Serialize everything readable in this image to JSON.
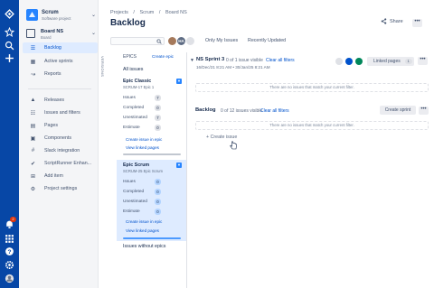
{
  "global_nav": {
    "icons": [
      "jira-logo-icon",
      "star-icon",
      "search-icon",
      "plus-icon",
      "notifications-icon",
      "apps-icon",
      "help-icon",
      "settings-icon",
      "profile-icon"
    ],
    "notification_count": "2",
    "bg_color": "#0747a6"
  },
  "project": {
    "name": "Scrum",
    "type": "Software project",
    "board_name": "Board NS",
    "board_sub": "Board"
  },
  "sidebar": {
    "primary": [
      {
        "label": "Backlog",
        "icon": "backlog-icon",
        "active": true
      },
      {
        "label": "Active sprints",
        "icon": "sprint-icon",
        "active": false
      },
      {
        "label": "Reports",
        "icon": "reports-icon",
        "active": false
      }
    ],
    "secondary": [
      {
        "label": "Releases",
        "icon": "ship-icon"
      },
      {
        "label": "Issues and filters",
        "icon": "issues-icon"
      },
      {
        "label": "Pages",
        "icon": "page-icon"
      },
      {
        "label": "Components",
        "icon": "component-icon"
      },
      {
        "label": "Slack integration",
        "icon": "slack-icon"
      },
      {
        "label": "ScriptRunner Enhan...",
        "icon": "scriptrunner-icon"
      },
      {
        "label": "Add item",
        "icon": "add-icon"
      },
      {
        "label": "Project settings",
        "icon": "gear-icon"
      }
    ]
  },
  "header": {
    "breadcrumbs": [
      "Projects",
      "/",
      "Scrum",
      "/",
      "Board NS"
    ],
    "title": "Backlog",
    "share_label": "Share",
    "more_label": "•••"
  },
  "filters": {
    "search_placeholder": "",
    "avatar_initials": "HA",
    "my_issues_label": "Only My Issues",
    "recently_updated_label": "Recently Updated"
  },
  "epics_panel": {
    "vertical_tab_label": "VERSIONS",
    "heading": "EPICS",
    "create_epic_label": "Create epic",
    "all_issues_label": "All issues",
    "epics": [
      {
        "name": "Epic Classic",
        "key": "SCRUM-17 Epic 1",
        "issues_label": "Issues",
        "issues": "7",
        "completed_label": "Completed",
        "completed": "0",
        "unestimated_label": "Unestimated",
        "unestimated": "7",
        "estimate_label": "Estimate",
        "estimate": "0",
        "issue_in_epic_label": "Create issue in epic",
        "linked_pages_label": "View linked pages",
        "selected": false,
        "progress": 0
      },
      {
        "name": "Epic Scrum",
        "key": "SCRUM-25 Epic Scrum",
        "issues_label": "Issues",
        "issues": "0",
        "completed_label": "Completed",
        "completed": "0",
        "unestimated_label": "Unestimated",
        "unestimated": "0",
        "estimate_label": "Estimate",
        "estimate": "0",
        "issue_in_epic_label": "Create issue in epic",
        "linked_pages_label": "View linked pages",
        "selected": true,
        "progress": 0
      }
    ],
    "without_epics_label": "Issues without epics"
  },
  "sprint": {
    "name": "NS Sprint 3",
    "count_text": "0 of 1 issue visible",
    "clear_filters_label": "Clear all filters",
    "dates": "16/Dec/21 8:21 AM • 30/Jan/25 8:21 AM",
    "linked_pages_label": "Linked pages",
    "linked_pages_count": "1",
    "empty_message": "There are no issues that match your current filter.",
    "status_colors": [
      "#dfe1e6",
      "#0052cc",
      "#00875a"
    ]
  },
  "backlog": {
    "name": "Backlog",
    "count_text": "0 of 12 issues visible",
    "clear_filters_label": "Clear all filters",
    "create_sprint_label": "Create sprint",
    "empty_message": "There are no issues that match your current filter.",
    "create_issue_label": "Create issue"
  }
}
